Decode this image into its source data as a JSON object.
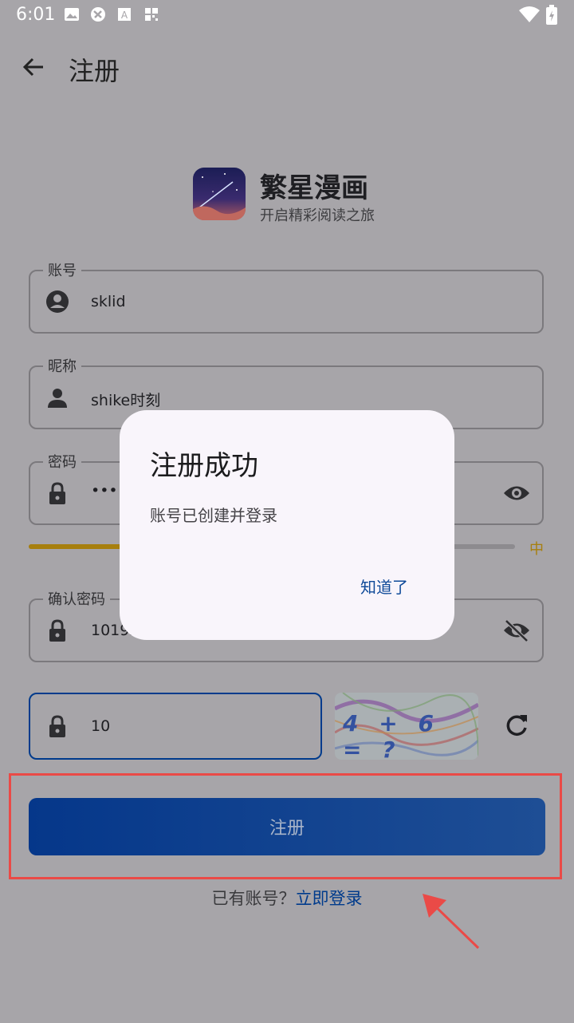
{
  "status_bar": {
    "time": "6:01",
    "icons": [
      "image-icon",
      "app-icon",
      "a-icon",
      "grid-icon",
      "wifi-icon",
      "battery-icon"
    ]
  },
  "app_bar": {
    "back_icon": "back-arrow-icon",
    "title": "注册"
  },
  "brand": {
    "name": "繁星漫画",
    "subtitle": "开启精彩阅读之旅"
  },
  "form": {
    "account": {
      "label": "账号",
      "value": "sklid",
      "icon": "account-circle-icon"
    },
    "nickname": {
      "label": "昵称",
      "value": "shike时刻",
      "icon": "person-icon"
    },
    "password": {
      "label": "密码",
      "value": "••••",
      "icon": "lock-icon",
      "toggle_icon": "eye-icon"
    },
    "strength": {
      "label": "中",
      "level": 0.36,
      "color": "#a77f0e"
    },
    "confirm_password": {
      "label": "确认密码",
      "value": "10192",
      "icon": "lock-icon",
      "toggle_icon": "eye-off-icon"
    },
    "captcha": {
      "value": "10",
      "icon": "lock-icon",
      "image_text": "4 + 6 = ?",
      "refresh_icon": "refresh-icon"
    }
  },
  "register_button": "注册",
  "login_prompt": {
    "text": "已有账号？",
    "link": "立即登录"
  },
  "dialog": {
    "title": "注册成功",
    "message": "账号已创建并登录",
    "confirm": "知道了"
  },
  "colors": {
    "primary": "#003b8c",
    "highlight": "#ea4a47",
    "strength": "#a77f0e"
  }
}
